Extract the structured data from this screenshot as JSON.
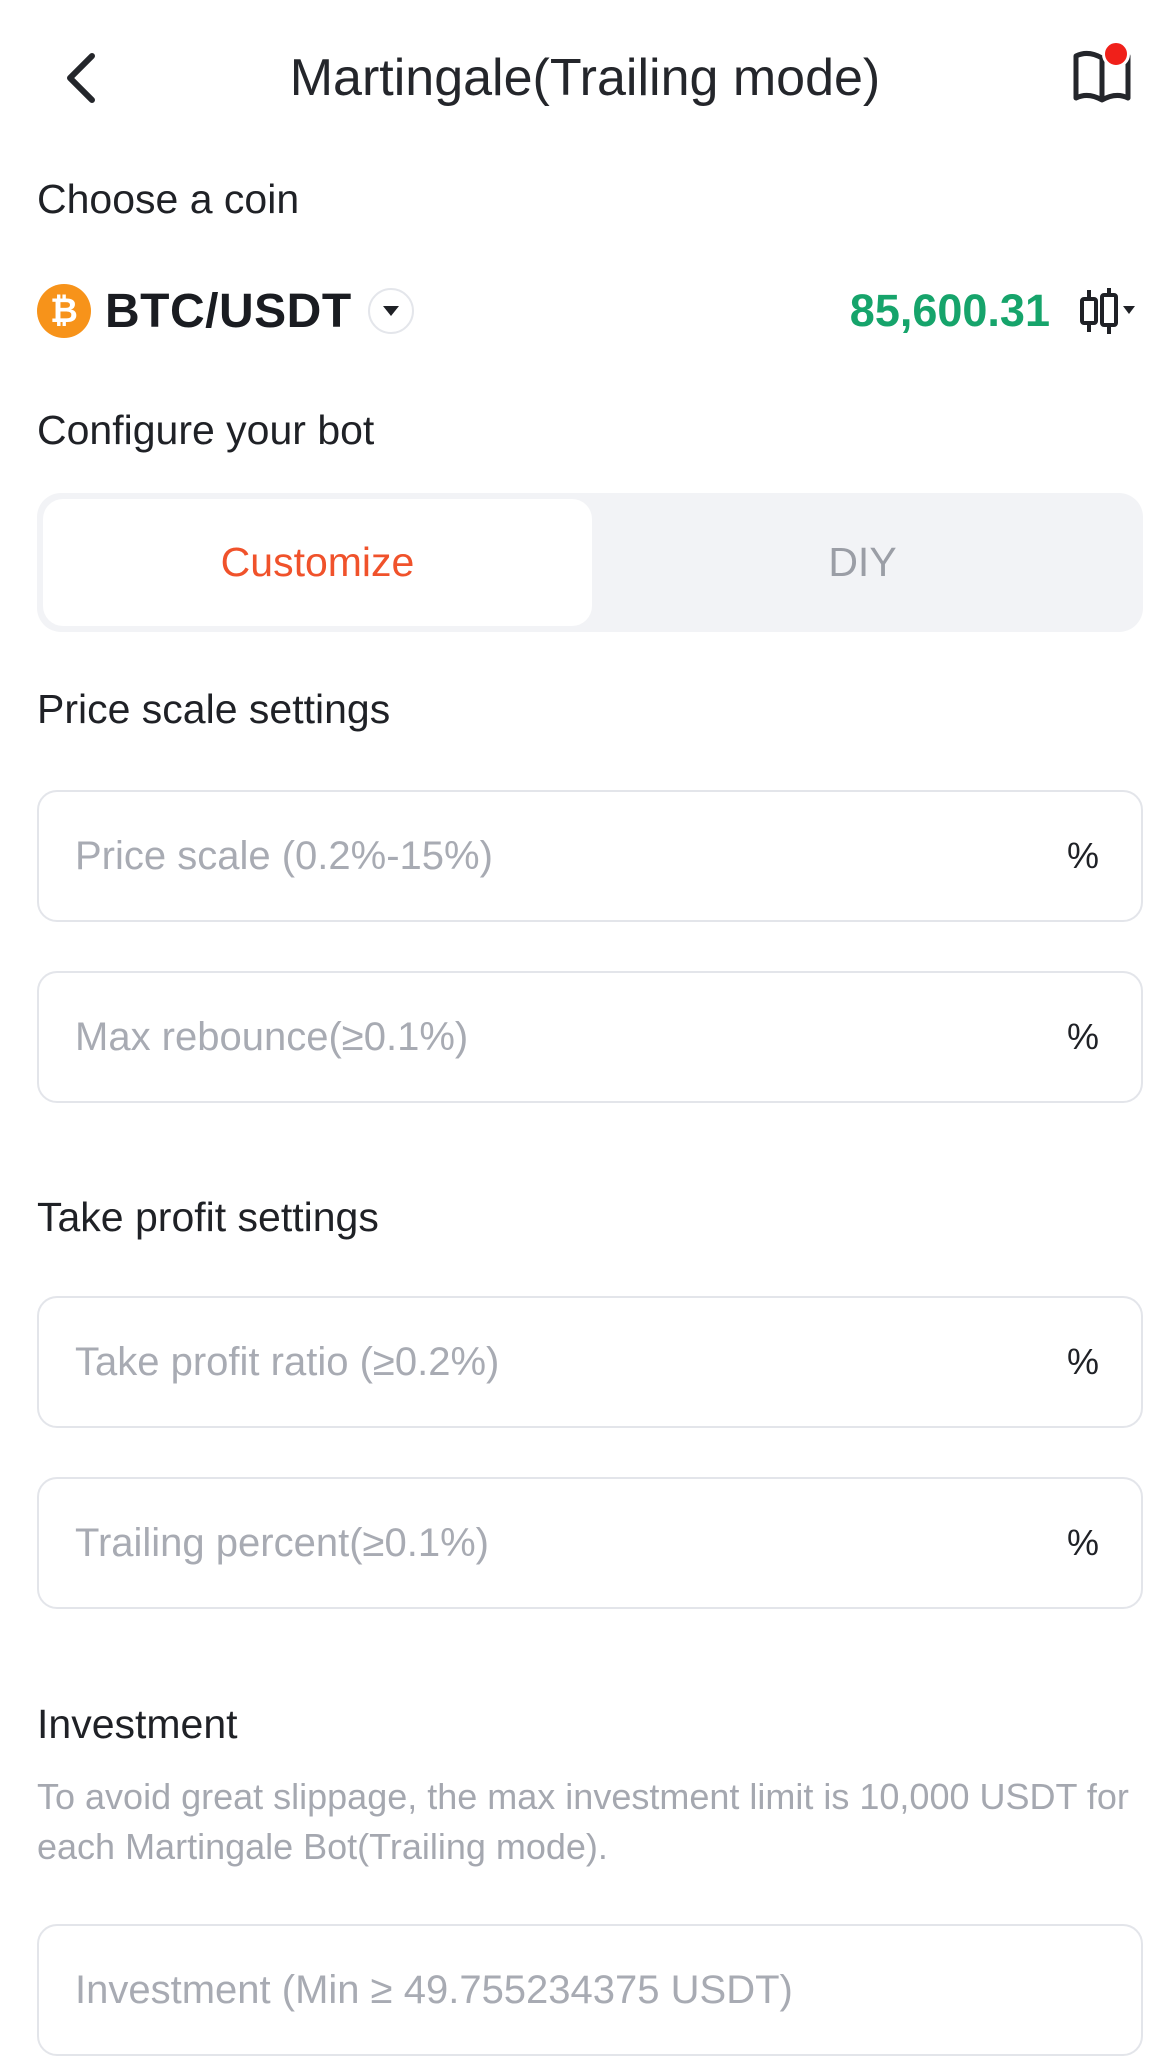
{
  "header": {
    "title": "Martingale(Trailing mode)",
    "back_icon": "chevron-left-icon",
    "guide_icon": "book-icon",
    "notification_dot_color": "#f0201a"
  },
  "coin_section": {
    "label": "Choose a coin",
    "pair": "BTC/USDT",
    "coin_symbol": "₿",
    "coin_color": "#f7931a",
    "price": "85,600.31",
    "price_color": "#16a46b",
    "chart_icon": "candlestick-chart-icon"
  },
  "config_section": {
    "label": "Configure your bot",
    "tabs": [
      {
        "label": "Customize",
        "active": true
      },
      {
        "label": "DIY",
        "active": false
      }
    ],
    "accent_color": "#f0522b"
  },
  "price_scale": {
    "label": "Price scale settings",
    "fields": [
      {
        "placeholder": "Price scale (0.2%-15%)",
        "unit": "%"
      },
      {
        "placeholder": "Max rebounce(≥0.1%)",
        "unit": "%"
      }
    ]
  },
  "take_profit": {
    "label": "Take profit settings",
    "fields": [
      {
        "placeholder": "Take profit ratio (≥0.2%)",
        "unit": "%"
      },
      {
        "placeholder": "Trailing percent(≥0.1%)",
        "unit": "%"
      }
    ]
  },
  "investment": {
    "label": "Investment",
    "note": "To avoid great slippage, the max investment limit is 10,000 USDT for each Martingale Bot(Trailing mode).",
    "placeholder": "Investment (Min ≥ 49.755234375 USDT)"
  }
}
